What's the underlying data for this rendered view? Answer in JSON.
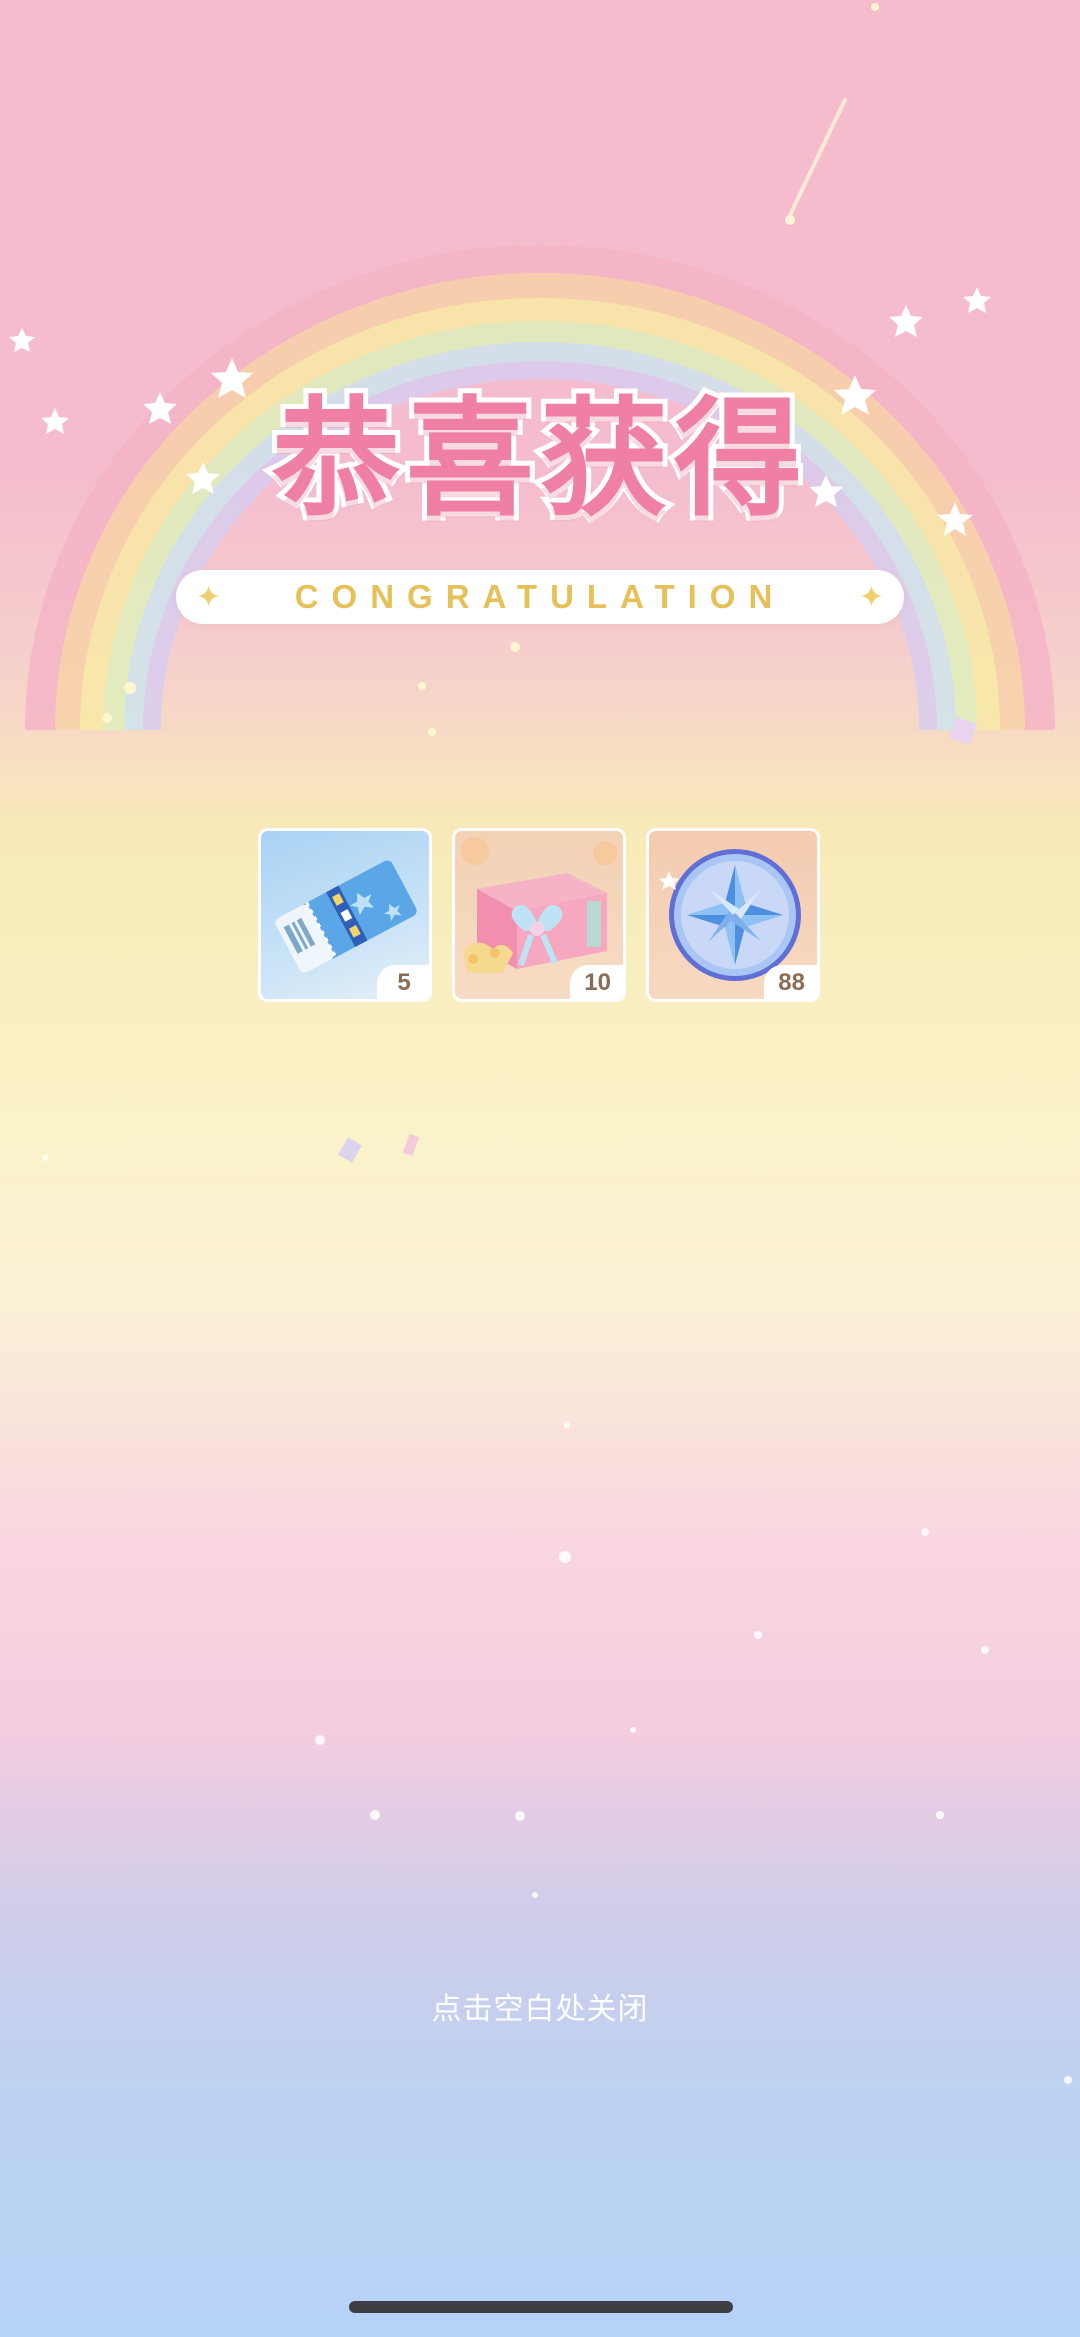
{
  "header": {
    "title": "恭喜获得",
    "subtitle": "CONGRATULATION"
  },
  "rewards": [
    {
      "name": "ticket",
      "icon": "ticket-icon",
      "quantity": "5"
    },
    {
      "name": "gift-box",
      "icon": "gift-box-icon",
      "quantity": "10"
    },
    {
      "name": "star-coin",
      "icon": "star-coin-icon",
      "quantity": "88"
    }
  ],
  "footer": {
    "close_hint": "点击空白处关闭"
  },
  "colors": {
    "title_pink": "#ef7fa3",
    "banner_gold": "#e6c15a",
    "bg_top": "#f4bccd",
    "bg_bottom": "#b6d2f6"
  }
}
